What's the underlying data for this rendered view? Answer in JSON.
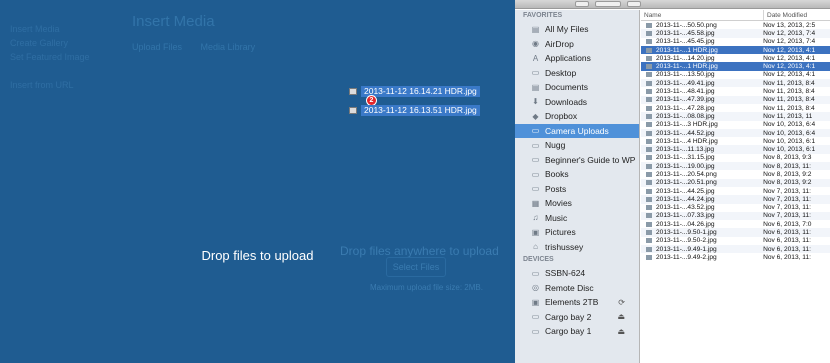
{
  "wordpress": {
    "sidebar": [
      "Insert Media",
      "Create Gallery",
      "Set Featured Image",
      "",
      "Insert from URL"
    ],
    "title": "Insert Media",
    "tabs": [
      "Upload Files",
      "Media Library"
    ],
    "ghost_heading": "Drop files anywhere to upload",
    "ghost_button": "Select Files",
    "ghost_note": "Maximum upload file size: 2MB.",
    "drop_label": "Drop files to upload",
    "drag_files": [
      "2013-11-12 16.14.21 HDR.jpg",
      "2013-11-12 16.13.51 HDR.jpg"
    ],
    "drag_count": "2"
  },
  "finder": {
    "favorites_header": "FAVORITES",
    "favorites": [
      {
        "label": "All My Files",
        "icon": "all-files-icon",
        "glyph": "▤",
        "selected": false
      },
      {
        "label": "AirDrop",
        "icon": "airdrop-icon",
        "glyph": "◉",
        "selected": false
      },
      {
        "label": "Applications",
        "icon": "applications-icon",
        "glyph": "A",
        "selected": false
      },
      {
        "label": "Desktop",
        "icon": "desktop-icon",
        "glyph": "▭",
        "selected": false
      },
      {
        "label": "Documents",
        "icon": "documents-icon",
        "glyph": "▤",
        "selected": false
      },
      {
        "label": "Downloads",
        "icon": "downloads-icon",
        "glyph": "⬇",
        "selected": false
      },
      {
        "label": "Dropbox",
        "icon": "dropbox-icon",
        "glyph": "◆",
        "selected": false
      },
      {
        "label": "Camera Uploads",
        "icon": "folder-icon",
        "glyph": "▭",
        "selected": true
      },
      {
        "label": "Nugg",
        "icon": "folder-icon",
        "glyph": "▭",
        "selected": false
      },
      {
        "label": "Beginner's Guide to WP",
        "icon": "folder-icon",
        "glyph": "▭",
        "selected": false
      },
      {
        "label": "Books",
        "icon": "folder-icon",
        "glyph": "▭",
        "selected": false
      },
      {
        "label": "Posts",
        "icon": "folder-icon",
        "glyph": "▭",
        "selected": false
      },
      {
        "label": "Movies",
        "icon": "movies-icon",
        "glyph": "▦",
        "selected": false
      },
      {
        "label": "Music",
        "icon": "music-icon",
        "glyph": "♫",
        "selected": false
      },
      {
        "label": "Pictures",
        "icon": "pictures-icon",
        "glyph": "▣",
        "selected": false
      },
      {
        "label": "trishussey",
        "icon": "home-icon",
        "glyph": "⌂",
        "selected": false
      }
    ],
    "devices_header": "DEVICES",
    "devices": [
      {
        "label": "SSBN-624",
        "icon": "computer-icon",
        "glyph": "▭",
        "eject": ""
      },
      {
        "label": "Remote Disc",
        "icon": "disc-icon",
        "glyph": "◎",
        "eject": ""
      },
      {
        "label": "Elements 2TB",
        "icon": "drive-icon",
        "glyph": "▣",
        "eject": "⟳"
      },
      {
        "label": "Cargo bay 2",
        "icon": "drive-icon",
        "glyph": "▭",
        "eject": "⏏"
      },
      {
        "label": "Cargo bay 1",
        "icon": "drive-icon",
        "glyph": "▭",
        "eject": "⏏"
      }
    ],
    "columns": {
      "name": "Name",
      "date": "Date Modified"
    },
    "files": [
      {
        "name": "2013-11-...50.50.png",
        "date": "Nov 13, 2013, 2:5",
        "selected": false
      },
      {
        "name": "2013-11-...45.58.jpg",
        "date": "Nov 12, 2013, 7:4",
        "selected": false
      },
      {
        "name": "2013-11-...45.45.jpg",
        "date": "Nov 12, 2013, 7:4",
        "selected": false
      },
      {
        "name": "2013-11-...1 HDR.jpg",
        "date": "Nov 12, 2013, 4:1",
        "selected": true
      },
      {
        "name": "2013-11-...14.20.jpg",
        "date": "Nov 12, 2013, 4:1",
        "selected": false
      },
      {
        "name": "2013-11-...1 HDR.jpg",
        "date": "Nov 12, 2013, 4:1",
        "selected": true
      },
      {
        "name": "2013-11-...13.50.jpg",
        "date": "Nov 12, 2013, 4:1",
        "selected": false
      },
      {
        "name": "2013-11-...49.41.jpg",
        "date": "Nov 11, 2013, 8:4",
        "selected": false
      },
      {
        "name": "2013-11-...48.41.jpg",
        "date": "Nov 11, 2013, 8:4",
        "selected": false
      },
      {
        "name": "2013-11-...47.39.jpg",
        "date": "Nov 11, 2013, 8:4",
        "selected": false
      },
      {
        "name": "2013-11-...47.28.jpg",
        "date": "Nov 11, 2013, 8:4",
        "selected": false
      },
      {
        "name": "2013-11-...08.08.jpg",
        "date": "Nov 11, 2013, 11",
        "selected": false
      },
      {
        "name": "2013-11-...3 HDR.jpg",
        "date": "Nov 10, 2013, 6:4",
        "selected": false
      },
      {
        "name": "2013-11-...44.52.jpg",
        "date": "Nov 10, 2013, 6:4",
        "selected": false
      },
      {
        "name": "2013-11-...4 HDR.jpg",
        "date": "Nov 10, 2013, 6:1",
        "selected": false
      },
      {
        "name": "2013-11-...11.13.jpg",
        "date": "Nov 10, 2013, 6:1",
        "selected": false
      },
      {
        "name": "2013-11-...31.15.jpg",
        "date": "Nov 8, 2013, 9:3",
        "selected": false
      },
      {
        "name": "2013-11-...19.00.jpg",
        "date": "Nov 8, 2013, 11:",
        "selected": false
      },
      {
        "name": "2013-11-...20.54.png",
        "date": "Nov 8, 2013, 9:2",
        "selected": false
      },
      {
        "name": "2013-11-...20.51.png",
        "date": "Nov 8, 2013, 9:2",
        "selected": false
      },
      {
        "name": "2013-11-...44.25.jpg",
        "date": "Nov 7, 2013, 11:",
        "selected": false
      },
      {
        "name": "2013-11-...44.24.jpg",
        "date": "Nov 7, 2013, 11:",
        "selected": false
      },
      {
        "name": "2013-11-...43.52.jpg",
        "date": "Nov 7, 2013, 11:",
        "selected": false
      },
      {
        "name": "2013-11-...07.33.jpg",
        "date": "Nov 7, 2013, 11:",
        "selected": false
      },
      {
        "name": "2013-11-...04.26.jpg",
        "date": "Nov 6, 2013, 7:0",
        "selected": false
      },
      {
        "name": "2013-11-...9.50-1.jpg",
        "date": "Nov 6, 2013, 11:",
        "selected": false
      },
      {
        "name": "2013-11-...9.50-2.jpg",
        "date": "Nov 6, 2013, 11:",
        "selected": false
      },
      {
        "name": "2013-11-...9.49-1.jpg",
        "date": "Nov 6, 2013, 11:",
        "selected": false
      },
      {
        "name": "2013-11-...9.49-2.jpg",
        "date": "Nov 6, 2013, 11:",
        "selected": false
      }
    ]
  }
}
